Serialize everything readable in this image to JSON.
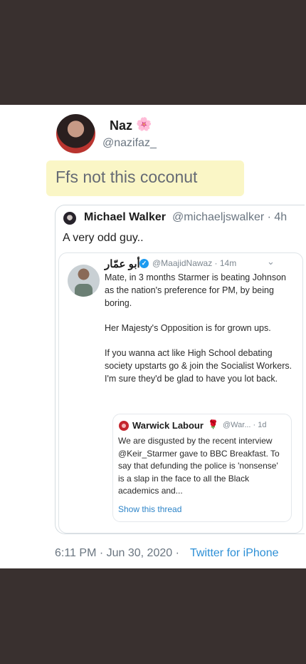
{
  "tweet": {
    "author_name": "Naz",
    "author_emoji": "🌸",
    "author_handle": "@nazifaz_",
    "text": "Ffs not this coconut",
    "timestamp": "6:11 PM · Jun 30, 2020 ·",
    "source": "Twitter for iPhone"
  },
  "quoted": {
    "author_name": "Michael Walker",
    "author_handle": "@michaeljswalker · 4h",
    "text": "A very odd guy..",
    "embedded": {
      "author_name": "أبو عمّار",
      "author_handle": "@MaajidNawaz · 14m",
      "paragraphs": [
        "Mate, in 3 months Starmer is beating Johnson as the nation's preference for PM, by being boring.",
        "Her Majesty's Opposition is for grown ups.",
        "If you wanna act like High School debating society upstarts go & join the Socialist Workers. I'm sure they'd be glad to have you lot back."
      ],
      "quote": {
        "author_name": "Warwick Labour",
        "author_emoji": "🌹",
        "author_handle": "@War... · 1d",
        "text": "We are disgusted by the recent interview @Keir_Starmer gave to BBC Breakfast. To say that defunding the police is 'nonsense' is a slap in the face to all the Black academics and...",
        "link": "Show this thread"
      }
    }
  },
  "icons": {
    "verified": "verified-badge-icon",
    "chevron": "chevron-down-icon",
    "reply": "reply-icon",
    "retweet": "retweet-icon",
    "like": "like-icon",
    "share": "share-icon"
  },
  "colors": {
    "background": "#39302f",
    "highlight": "#faf6c6",
    "link": "#2d8fd6",
    "verified": "#1d9bf0"
  }
}
